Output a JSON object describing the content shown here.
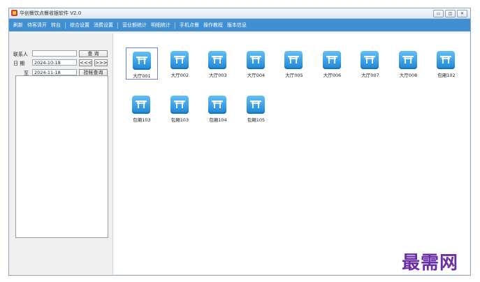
{
  "window": {
    "title": "华创餐饮点餐收银软件 V2.0",
    "controls": [
      "▭",
      "◫",
      "✕"
    ]
  },
  "menu": [
    {
      "label": "刷新"
    },
    {
      "label": "待客清开"
    },
    {
      "label": "转台"
    },
    {
      "sep": true
    },
    {
      "label": "综合设置"
    },
    {
      "label": "消费设置"
    },
    {
      "sep": true
    },
    {
      "label": "营业额统计"
    },
    {
      "label": "明细统计"
    },
    {
      "sep": true
    },
    {
      "label": "手机点餐"
    },
    {
      "label": "操作教程"
    },
    {
      "label": "版本信息"
    }
  ],
  "left": {
    "contact_label": "联系人",
    "contact_value": "",
    "query_label": "查  询",
    "date_label": "日  期",
    "date_from": "2024-10-18",
    "prev_label": "<<<",
    "next_label": ">>>",
    "to_label": "至",
    "date_to": "2024-11-18",
    "bill_query_label": "挂帐查询"
  },
  "rooms": [
    {
      "name": "大厅001",
      "selected": true
    },
    {
      "name": "大厅002"
    },
    {
      "name": "大厅003"
    },
    {
      "name": "大厅004"
    },
    {
      "name": "大厅005"
    },
    {
      "name": "大厅006"
    },
    {
      "name": "大厅007"
    },
    {
      "name": "大厅008"
    },
    {
      "name": "包厢102"
    },
    {
      "name": "包厢103"
    },
    {
      "name": "包厢103"
    },
    {
      "name": "包厢104"
    },
    {
      "name": "包厢105"
    }
  ],
  "watermark": "最需网"
}
